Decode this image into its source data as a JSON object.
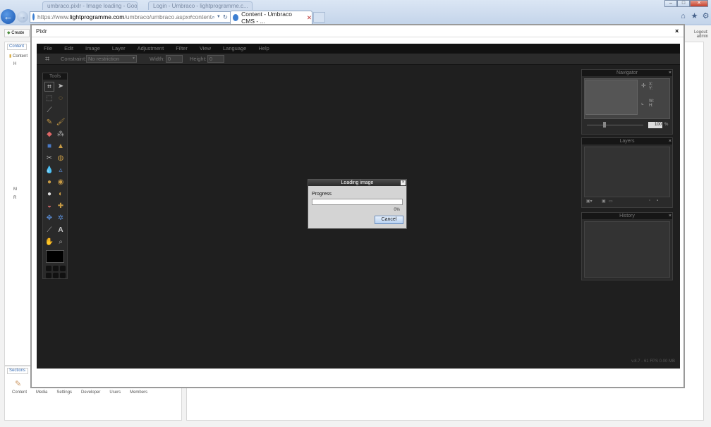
{
  "browser": {
    "bg_tabs": [
      "umbraco.pixlr - Image loading - Goo...",
      "Login - Umbraco - lightprogramme.c..."
    ],
    "address_prefix": "https://www.",
    "address_domain": "lightprogramme.com",
    "address_path": "/umbraco/umbraco.aspx#content",
    "active_tab": "Content - Umbraco CMS - ...",
    "address_icons": [
      "search-icon",
      "dropdown-icon",
      "refresh-icon"
    ],
    "win_min": "–",
    "win_max": "□",
    "win_close": "✕",
    "right_icons": [
      "home-icon",
      "star-icon",
      "gear-icon"
    ]
  },
  "umbraco": {
    "create_label": "Create",
    "user_label": "Logout: admin",
    "content_tab": "Content",
    "tree_root": "Content",
    "tree_items": [
      "H",
      "M",
      "R"
    ],
    "sections_title": "Sections",
    "sections": [
      "Content",
      "Media",
      "Settings",
      "Developer",
      "Users",
      "Members"
    ]
  },
  "modal": {
    "title": "Pixlr",
    "close": "×"
  },
  "pixlr": {
    "menu": [
      "File",
      "Edit",
      "Image",
      "Layer",
      "Adjustment",
      "Filter",
      "View",
      "Language",
      "Help"
    ],
    "constraint_label": "Constraint:",
    "constraint_value": "No restriction",
    "width_label": "Width:",
    "width_value": "0",
    "height_label": "Height:",
    "height_value": "0",
    "tools_title": "Tools",
    "navigator_title": "Navigator",
    "nav_x": "X:",
    "nav_y": "Y:",
    "nav_w": "W:",
    "nav_h": "H:",
    "zoom_value": "100",
    "zoom_unit": "%",
    "layers_title": "Layers",
    "history_title": "History",
    "status_text": "v.8.7 - 61 FPS 0.00 MB",
    "close_glyph": "×"
  },
  "dialog": {
    "title": "Loading image",
    "label": "Progress",
    "progress_fraction": 0.0,
    "percent": "0%",
    "cancel": "Cancel"
  }
}
